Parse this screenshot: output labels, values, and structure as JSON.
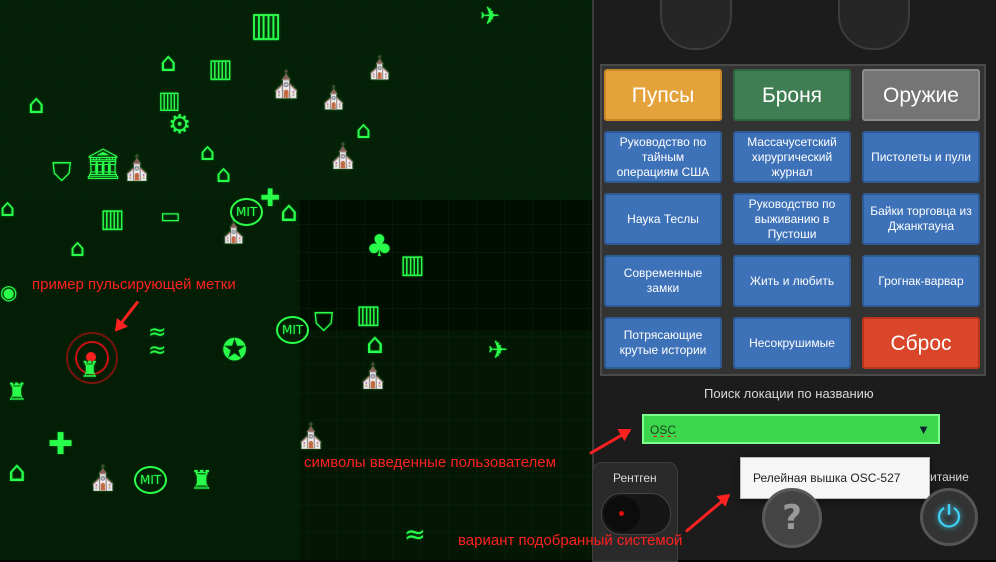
{
  "filters": {
    "row1": [
      "Пупсы",
      "Броня",
      "Оружие"
    ],
    "row2": [
      "Руководство по тайным операциям США",
      "Массачусетский хирургический журнал",
      "Пистолеты и пули"
    ],
    "row3": [
      "Наука Теслы",
      "Руководство по выживанию в Пустоши",
      "Байки торговца из Джанктауна"
    ],
    "row4": [
      "Современные замки",
      "Жить и любить",
      "Грогнак-варвар"
    ],
    "row5": [
      "Потрясающие крутые истории",
      "Несокрушимые",
      "Сброс"
    ]
  },
  "colors": {
    "pupsy": "#e4a33a",
    "armor": "#3f7e52",
    "weapons": "#757575",
    "reset": "#d9462a",
    "map_green": "#29ff4a"
  },
  "search": {
    "label": "Поиск локации по названию",
    "value": "OSC",
    "suggestion": "Релейная вышка OSC-527"
  },
  "bottom": {
    "xray_label": "Рентген",
    "power_label": "итание"
  },
  "annotations": {
    "pulse": "пример пульсирующей метки",
    "typed": "символы введенные пользователем",
    "suggested": "вариант подобранный системой"
  },
  "map_markers": {
    "mit_label": "MIT",
    "icons": [
      "house-icon",
      "factory-icon",
      "church-icon",
      "shield-star-icon",
      "clover-icon",
      "cross-icon",
      "airplane-icon",
      "tower-icon"
    ]
  }
}
